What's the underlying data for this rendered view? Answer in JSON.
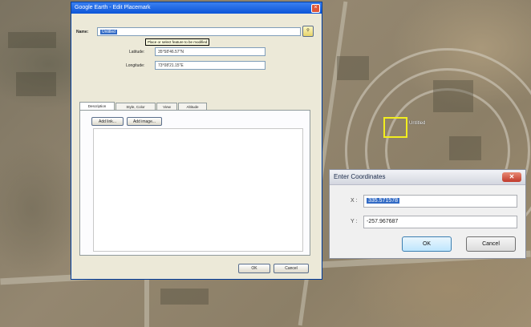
{
  "placemark_dialog": {
    "title": "Google Earth - Edit Placemark",
    "name_label": "Name:",
    "name_value": "Untitled",
    "tooltip": "Place or select feature to be modified",
    "latitude_label": "Latitude:",
    "latitude_value": "35°58'46.57\"N",
    "longitude_label": "Longitude:",
    "longitude_value": "73°08'21.15\"E",
    "tabs": [
      "Description",
      "Style, Color",
      "View",
      "Altitude"
    ],
    "add_link_label": "Add link...",
    "add_image_label": "Add image...",
    "ok_label": "OK",
    "cancel_label": "Cancel"
  },
  "enter_coordinates": {
    "title": "Enter Coordinates",
    "close_glyph": "✕",
    "x_label": "X :",
    "x_value": "335.571578",
    "y_label": "Y :",
    "y_value": "-257.967687",
    "ok_label": "OK",
    "cancel_label": "Cancel"
  },
  "map": {
    "marker_label": "Untitled"
  },
  "colors": {
    "title_blue": "#0c55d8",
    "marker_yellow": "#f2ee1e",
    "selection": "#316ac5"
  }
}
